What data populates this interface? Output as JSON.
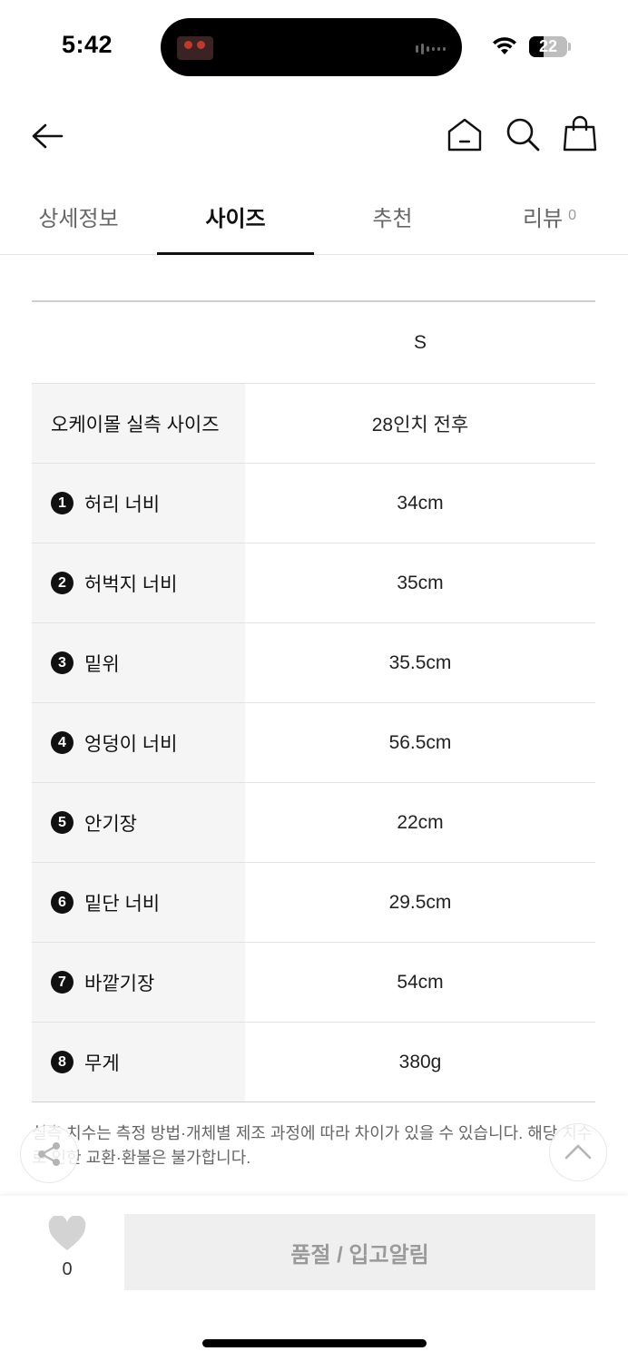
{
  "status_bar": {
    "time": "5:42",
    "battery": "22",
    "icons": [
      "wifi-icon",
      "battery-icon"
    ]
  },
  "nav": {
    "icons": [
      "back-arrow-icon",
      "home-icon",
      "search-icon",
      "shopping-bag-icon"
    ]
  },
  "tabs": [
    {
      "label": "상세정보",
      "active": false
    },
    {
      "label": "사이즈",
      "active": true
    },
    {
      "label": "추천",
      "active": false
    },
    {
      "label": "리뷰",
      "count": "0",
      "active": false
    }
  ],
  "size_table": {
    "header": {
      "label": "",
      "size": "S"
    },
    "rows": [
      {
        "num": "",
        "label": "오케이몰 실측 사이즈",
        "value": "28인치 전후"
      },
      {
        "num": "1",
        "label": "허리 너비",
        "value": "34cm"
      },
      {
        "num": "2",
        "label": "허벅지 너비",
        "value": "35cm"
      },
      {
        "num": "3",
        "label": "밑위",
        "value": "35.5cm"
      },
      {
        "num": "4",
        "label": "엉덩이 너비",
        "value": "56.5cm"
      },
      {
        "num": "5",
        "label": "안기장",
        "value": "22cm"
      },
      {
        "num": "6",
        "label": "밑단 너비",
        "value": "29.5cm"
      },
      {
        "num": "7",
        "label": "바깥기장",
        "value": "54cm"
      },
      {
        "num": "8",
        "label": "무게",
        "value": "380g"
      }
    ]
  },
  "notice": "실측 치수는 측정 방법·개체별 제조 과정에 따라 차이가 있을 수 있습니다. 해당 치수로 인한 교환·환불은 불가합니다.",
  "bottom_bar": {
    "like_count": "0",
    "soldout_label": "품절 / 입고알림"
  },
  "colors": {
    "accent": "#111111",
    "label_bg": "#f5f5f5",
    "button_bg": "#efefef",
    "button_text": "#9a9a9a"
  }
}
